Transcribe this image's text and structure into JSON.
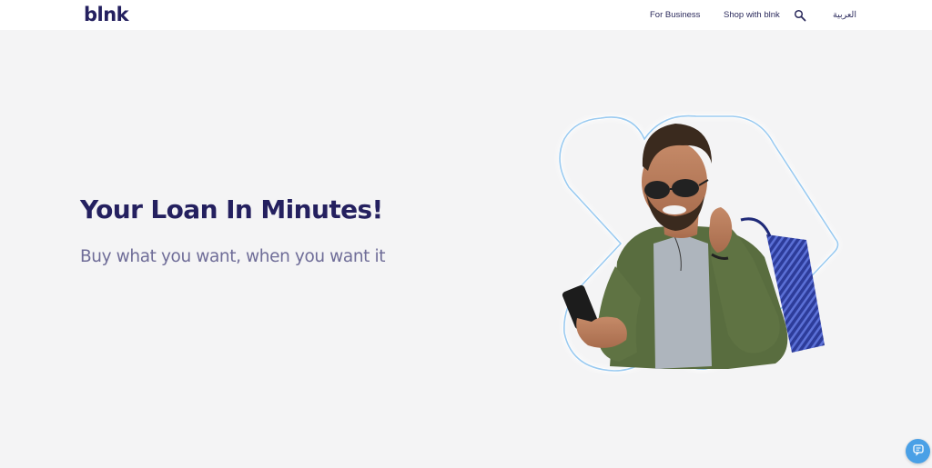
{
  "header": {
    "logo_text": "blnk",
    "nav": {
      "for_business": "For Business",
      "shop_with_blnk": "Shop with blnk",
      "language": "العربية"
    },
    "icons": {
      "search": "search-icon"
    }
  },
  "hero": {
    "headline": "Your Loan In Minutes!",
    "subheadline": "Buy what you want, when you want it",
    "image": "man-with-phone-and-shopping-bag",
    "decoration": "glowing-heart-outline"
  },
  "chat": {
    "icon": "chat-icon"
  },
  "colors": {
    "brand_navy": "#24205f",
    "subtitle": "#6f6d98",
    "background": "#f4f4f5",
    "accent_blue": "#4aa0e6",
    "glow": "#8fc4ee"
  }
}
